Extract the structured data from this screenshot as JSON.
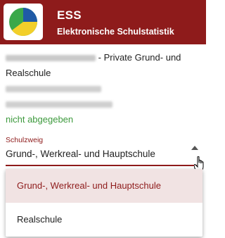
{
  "header": {
    "title": "ESS",
    "subtitle": "Elektronische Schulstatistik",
    "logo_icon": "pie-chart-logo-icon",
    "colors": {
      "bar": "#8e1b1b",
      "logo_blue": "#1f5aa6",
      "logo_green": "#3aa84a",
      "logo_yellow": "#f2cf2a"
    }
  },
  "school": {
    "name_suffix": "- Private Grund- und",
    "name_line2": "Realschule",
    "status": "nicht abgegeben",
    "status_color": "#3d9a3d"
  },
  "field": {
    "label": "Schulzweig",
    "value": "Grund-, Werkreal- und Hauptschule"
  },
  "dropdown": {
    "options": [
      {
        "label": "Grund-, Werkreal- und Hauptschule",
        "selected": true
      },
      {
        "label": "Realschule",
        "selected": false
      }
    ]
  }
}
